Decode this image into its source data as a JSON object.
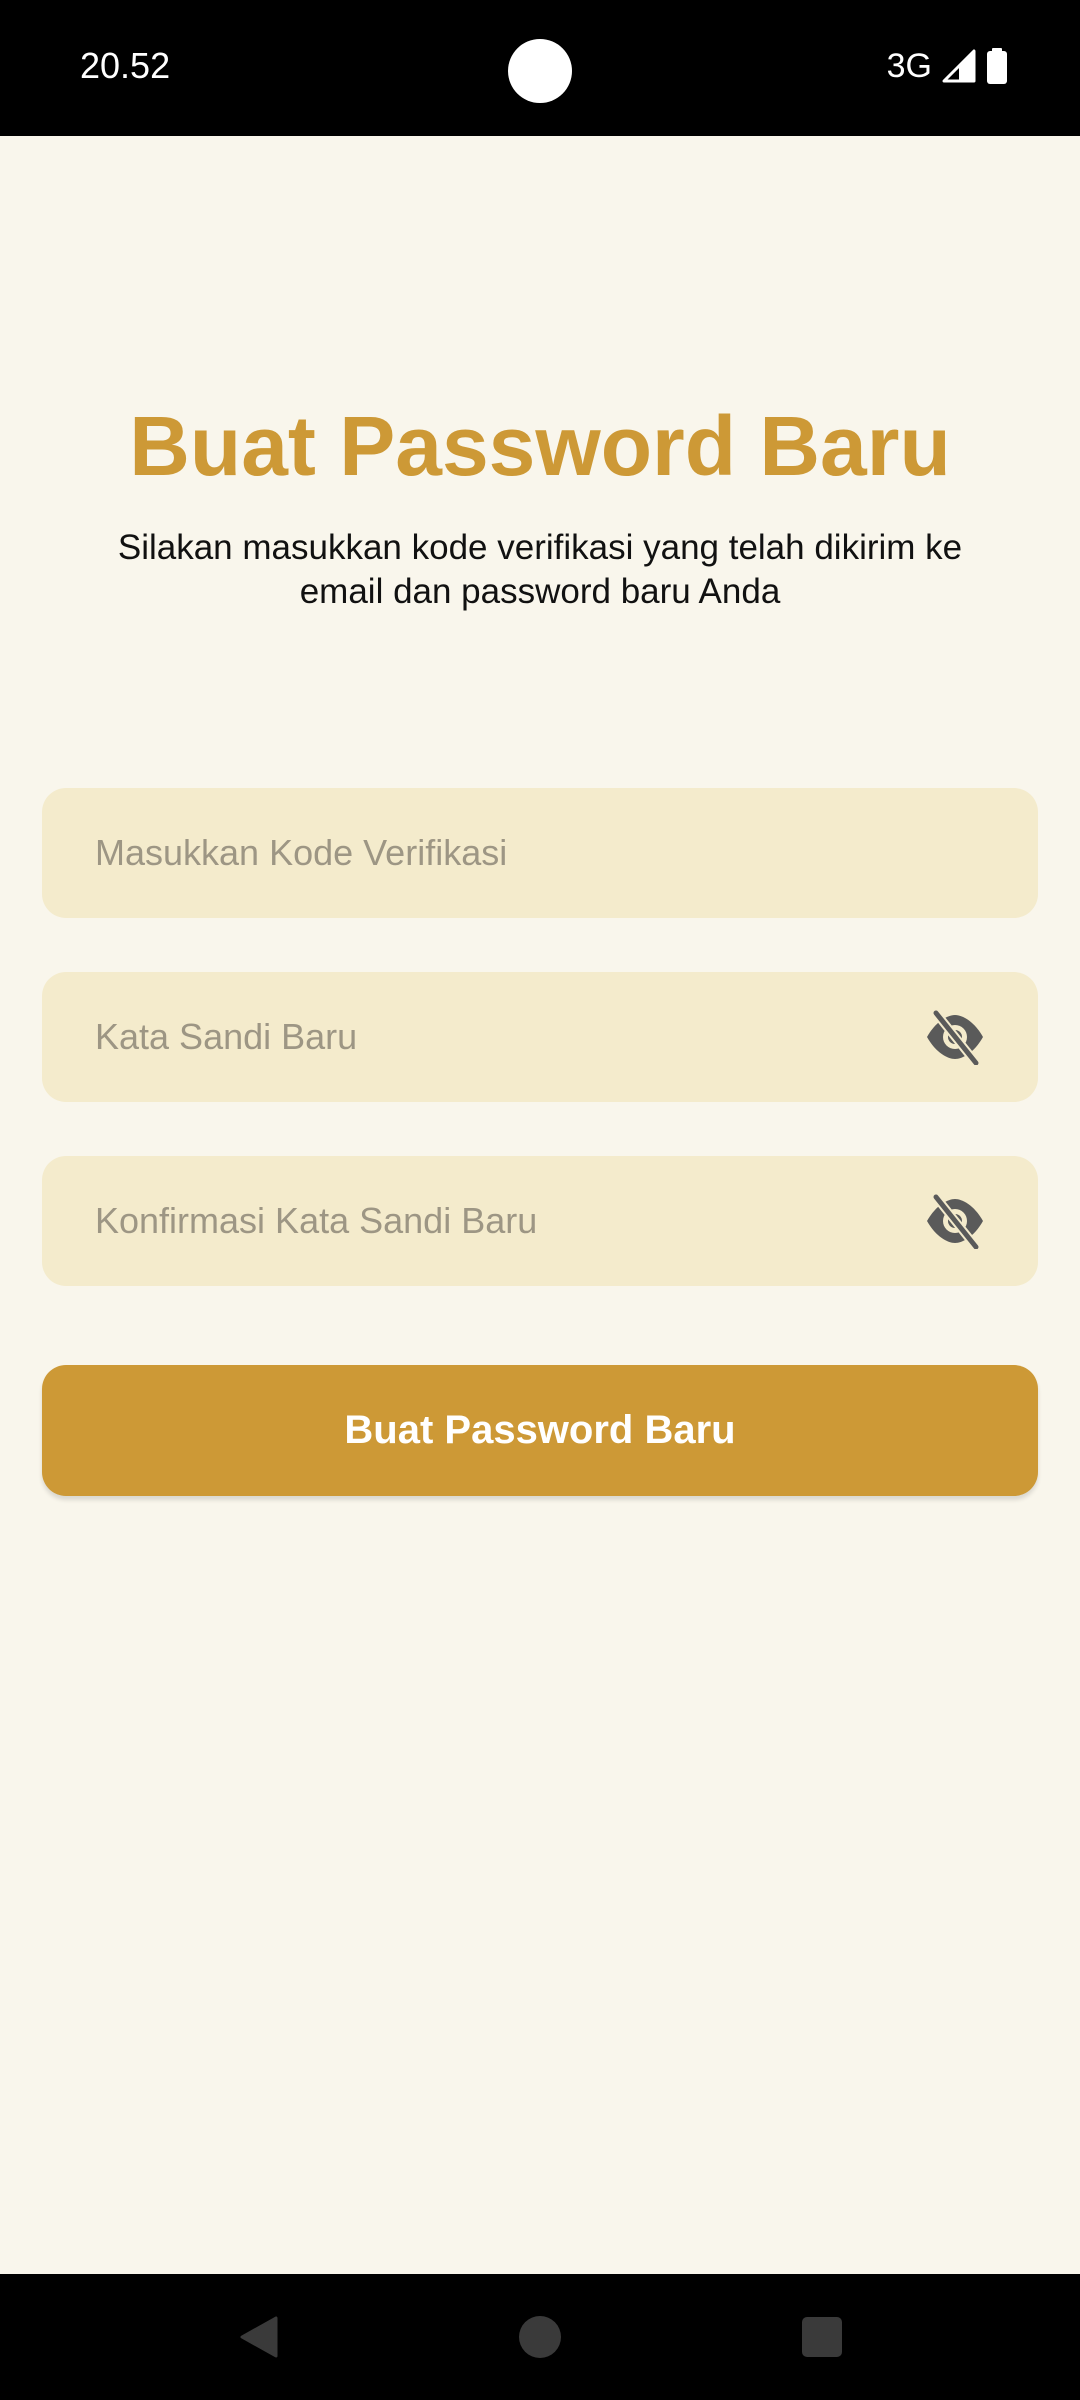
{
  "status_bar": {
    "time": "20.52",
    "network": "3G",
    "icons": [
      "signal-icon",
      "battery-icon"
    ]
  },
  "screen": {
    "title": "Buat Password Baru",
    "subtitle": "Silakan masukkan kode verifikasi yang telah dikirim ke email dan password baru Anda"
  },
  "form": {
    "verification_code": {
      "value": "",
      "placeholder": "Masukkan Kode Verifikasi"
    },
    "new_password": {
      "value": "",
      "placeholder": "Kata Sandi Baru",
      "toggle_icon": "eye-off-icon"
    },
    "confirm_password": {
      "value": "",
      "placeholder": "Konfirmasi Kata Sandi Baru",
      "toggle_icon": "eye-off-icon"
    },
    "submit_label": "Buat Password Baru"
  },
  "nav_bar": {
    "icons": [
      "back-icon",
      "home-icon",
      "recents-icon"
    ]
  },
  "colors": {
    "accent": "#cd9936",
    "background": "#f9f6ec",
    "field_background": "#f4ebcc",
    "placeholder": "#9d9684"
  }
}
